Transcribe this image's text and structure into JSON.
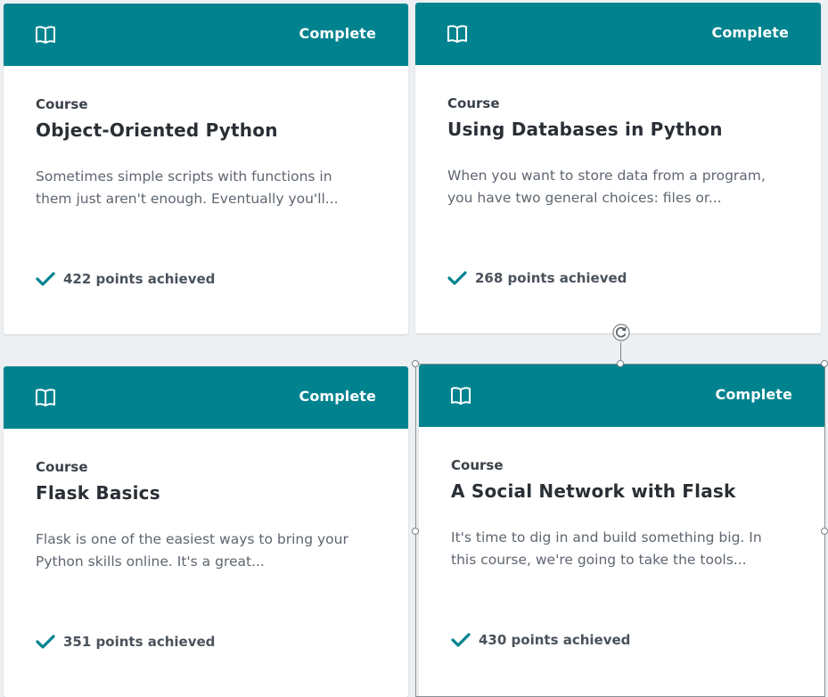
{
  "colors": {
    "accent": "#00838f",
    "background": "#edf0f2",
    "card": "#ffffff"
  },
  "cards": [
    {
      "icon": "book-icon",
      "status": "Complete",
      "type": "Course",
      "title": "Object-Oriented Python",
      "description": "Sometimes simple scripts with functions in them just aren't enough. Eventually you'll...",
      "points": "422 points achieved"
    },
    {
      "icon": "book-icon",
      "status": "Complete",
      "type": "Course",
      "title": "Using Databases in Python",
      "description": "When you want to store data from a program, you have two general choices: files or...",
      "points": "268 points achieved"
    },
    {
      "icon": "book-icon",
      "status": "Complete",
      "type": "Course",
      "title": "Flask Basics",
      "description": "Flask is one of the easiest ways to bring your Python skills online. It's a great...",
      "points": "351 points achieved"
    },
    {
      "icon": "book-icon",
      "status": "Complete",
      "type": "Course",
      "title": "A Social Network with Flask",
      "description": "It's time to dig in and build something big. In this course, we're going to take the tools...",
      "points": "430 points achieved"
    }
  ]
}
